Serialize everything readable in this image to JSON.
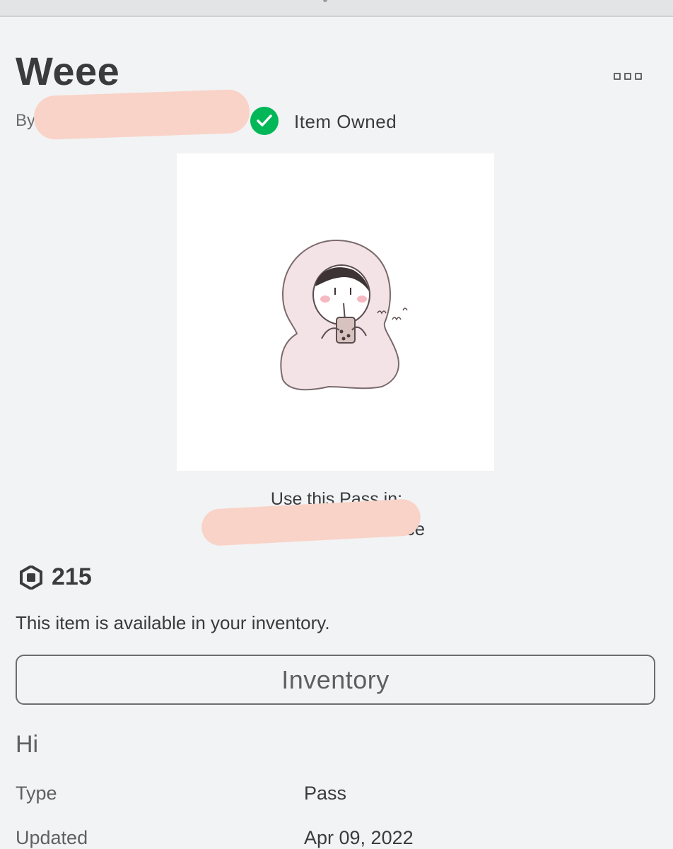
{
  "item": {
    "title": "Weee",
    "by_label": "By",
    "owned_label": "Item Owned",
    "use_in_label": "Use this Pass in:",
    "place_suffix": "Place",
    "price": "215",
    "availability_text": "This item is available in your inventory.",
    "inventory_button_label": "Inventory",
    "description": "Hi"
  },
  "details": [
    {
      "label": "Type",
      "value": "Pass"
    },
    {
      "label": "Updated",
      "value": "Apr 09, 2022"
    }
  ],
  "icons": {
    "owned": "check-circle-icon",
    "price": "robux-icon",
    "more": "more-options-icon"
  },
  "colors": {
    "owned_green": "#02b757",
    "background": "#f2f3f5",
    "text": "#393b3d"
  }
}
